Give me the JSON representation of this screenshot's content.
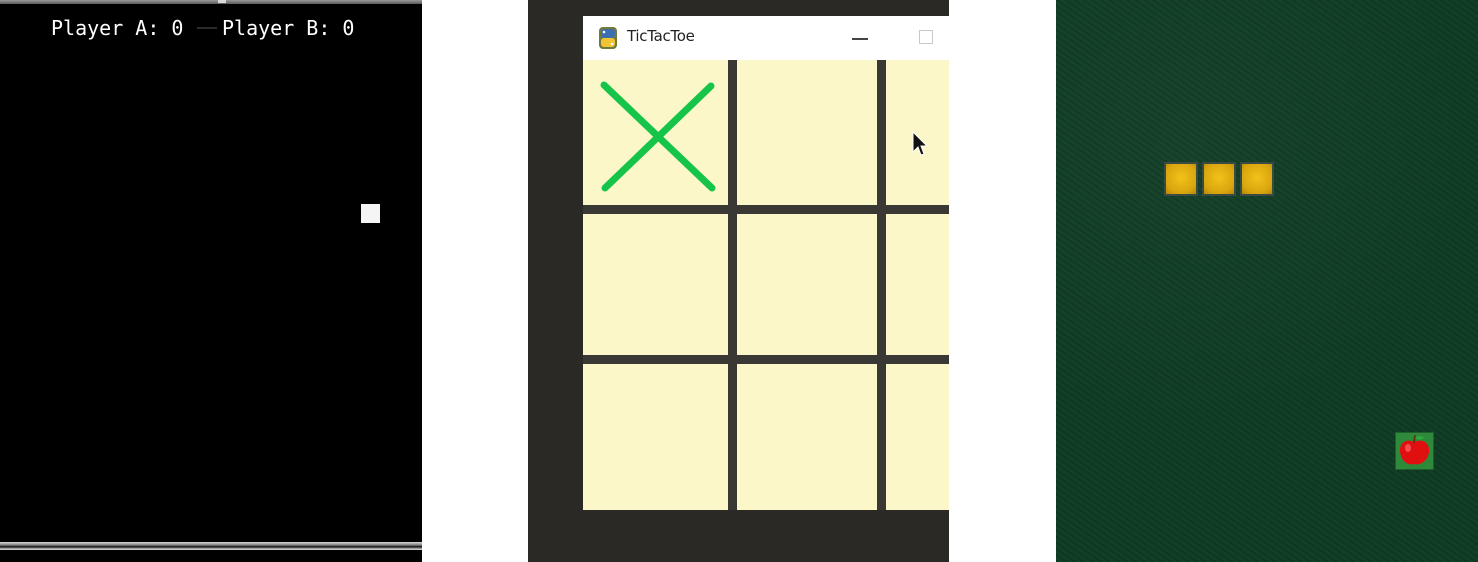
{
  "pong": {
    "score_a": "Player A: 0",
    "score_b": "Player B: 0",
    "background_color": "#000000",
    "ball_color": "#f5f5f5"
  },
  "tictactoe": {
    "window_title": "TicTacToe",
    "app_icon": "python-icon",
    "board_color": "#fbf7c8",
    "grid_color": "#3a3834",
    "mark_color": "#17c44a",
    "cells": [
      "X",
      "",
      "",
      "",
      "",
      "",
      "",
      "",
      ""
    ]
  },
  "snake": {
    "background_color": "#0d3a22",
    "snake_color": "#e0ab10",
    "snake_length": 3,
    "food": "apple-icon",
    "food_color": "#e01010"
  }
}
